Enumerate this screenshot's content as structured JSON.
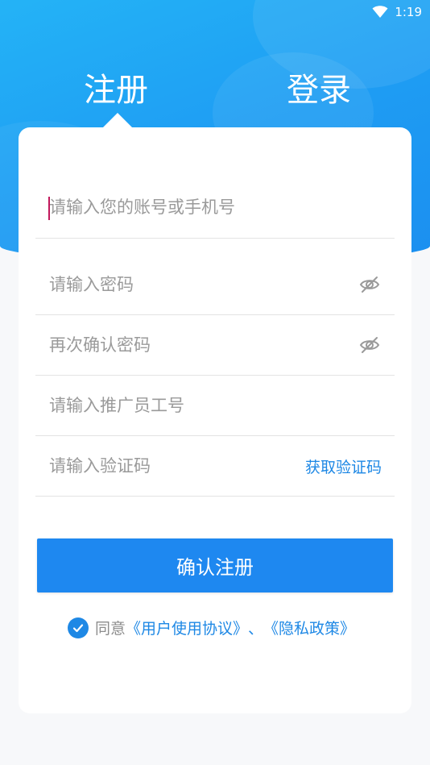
{
  "status_bar": {
    "time": "1:19",
    "wifi_icon": "wifi-icon"
  },
  "tabs": {
    "register": "注册",
    "login": "登录"
  },
  "form": {
    "account_placeholder": "请输入您的账号或手机号",
    "password_placeholder": "请输入密码",
    "confirm_password_placeholder": "再次确认密码",
    "staff_id_placeholder": "请输入推广员工号",
    "code_placeholder": "请输入验证码",
    "get_code_label": "获取验证码",
    "eye_icon": "eye-off-icon"
  },
  "submit_label": "确认注册",
  "agreement": {
    "prefix": "同意",
    "user_agreement": "《用户使用协议》",
    "separator": "、",
    "privacy_policy": "《隐私政策》",
    "checked": true
  },
  "colors": {
    "header_gradient_start": "#24b3f6",
    "header_gradient_end": "#1b8ff0",
    "accent": "#1e88e5",
    "button": "#1e88f0",
    "cursor": "#c2185b",
    "background": "#f7f8fa"
  }
}
